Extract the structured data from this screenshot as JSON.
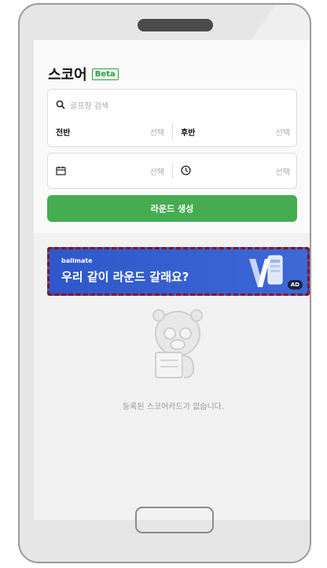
{
  "header": {
    "title": "스코어",
    "badge": "Beta"
  },
  "course_card": {
    "search_placeholder": "골프장 검색",
    "front_label": "전반",
    "front_value": "선택",
    "back_label": "후반",
    "back_value": "선택"
  },
  "datetime_card": {
    "date_value": "선택",
    "time_value": "선택"
  },
  "create_button": {
    "label": "라운드 생성"
  },
  "ad": {
    "brand": "ballmate",
    "text": "우리 같이 라운드 갈래요?",
    "tag": "AD"
  },
  "empty": {
    "text": "등록된 스코어카드가 없습니다."
  },
  "colors": {
    "accent": "#46ac50",
    "ad_bg": "#2f57c9",
    "ad_border": "#8a1010"
  }
}
